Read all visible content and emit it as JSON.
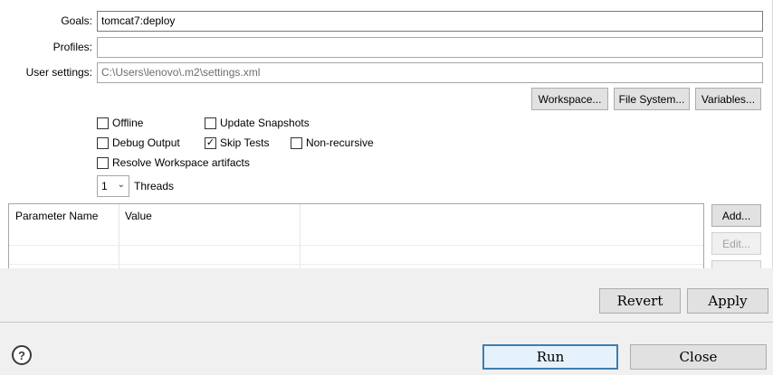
{
  "fields": {
    "goals": {
      "label": "Goals:",
      "value": "tomcat7:deploy"
    },
    "profiles": {
      "label": "Profiles:",
      "value": ""
    },
    "user_settings": {
      "label": "User settings:",
      "value": "C:\\Users\\lenovo\\.m2\\settings.xml"
    }
  },
  "buttons": {
    "workspace": "Workspace...",
    "file_system": "File System...",
    "variables": "Variables...",
    "add": "Add...",
    "edit": "Edit...",
    "revert": "Revert",
    "apply": "Apply",
    "run": "Run",
    "close": "Close"
  },
  "options": {
    "offline": {
      "label": "Offline",
      "checked": false
    },
    "update_snapshots": {
      "label": "Update Snapshots",
      "checked": false
    },
    "debug_output": {
      "label": "Debug Output",
      "checked": false
    },
    "skip_tests": {
      "label": "Skip Tests",
      "checked": true
    },
    "non_recursive": {
      "label": "Non-recursive",
      "checked": false
    },
    "resolve_workspace": {
      "label": "Resolve Workspace artifacts",
      "checked": false
    }
  },
  "threads": {
    "value": "1",
    "label": "Threads"
  },
  "parameter_table": {
    "columns": [
      "Parameter Name",
      "Value"
    ],
    "rows": []
  },
  "help": {
    "glyph": "?"
  },
  "colors": {
    "default_button_border": "#3c7fb1",
    "panel_background": "#ffffff",
    "window_background": "#f0f0f0"
  }
}
